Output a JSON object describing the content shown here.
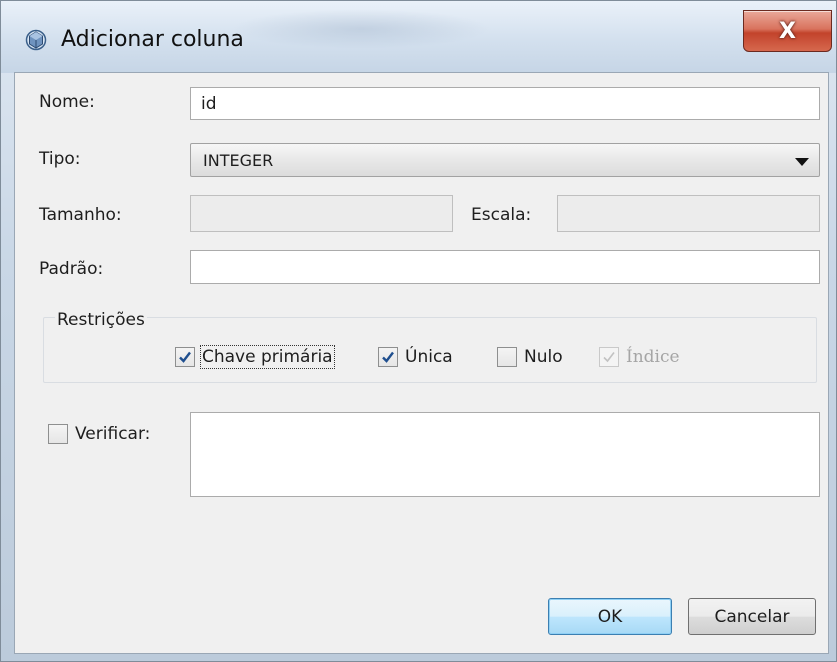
{
  "window": {
    "title": "Adicionar coluna",
    "close_label": "X"
  },
  "form": {
    "nome_label": "Nome:",
    "nome_value": "id",
    "tipo_label": "Tipo:",
    "tipo_value": "INTEGER",
    "tamanho_label": "Tamanho:",
    "tamanho_value": "",
    "escala_label": "Escala:",
    "escala_value": "",
    "padrao_label": "Padrão:",
    "padrao_value": ""
  },
  "restricoes": {
    "title": "Restrições",
    "chave_primaria": {
      "label": "Chave primária",
      "checked": true,
      "enabled": true
    },
    "unica": {
      "label": "Única",
      "checked": true,
      "enabled": true
    },
    "nulo": {
      "label": "Nulo",
      "checked": false,
      "enabled": true
    },
    "indice": {
      "label": "Índice",
      "checked": true,
      "enabled": false
    }
  },
  "verificar": {
    "label": "Verificar:",
    "checked": false,
    "value": ""
  },
  "buttons": {
    "ok": "OK",
    "cancel": "Cancelar"
  },
  "colors": {
    "accent": "#3c7fb1",
    "check_mark": "#1f4f8f",
    "close_button": "#c2432b"
  }
}
